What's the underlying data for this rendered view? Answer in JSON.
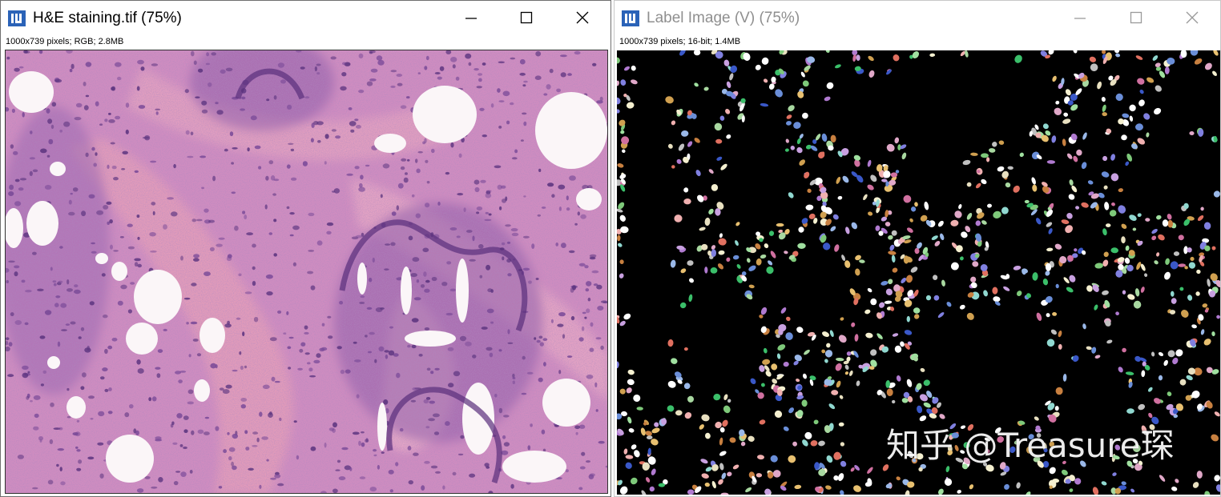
{
  "windows": [
    {
      "title": "H&E staining.tif (75%)",
      "info": "1000x739 pixels; RGB; 2.8MB",
      "icon": "imagej-app-icon",
      "active": true
    },
    {
      "title": "Label Image (V) (75%)",
      "info": "1000x739 pixels; 16-bit; 1.4MB",
      "icon": "imagej-app-icon",
      "active": false
    }
  ],
  "watermark": "知乎 @Treasure琛",
  "colors": {
    "he_pink": "#cf86bd",
    "he_purple": "#6b3f86",
    "label_background": "#000000"
  }
}
